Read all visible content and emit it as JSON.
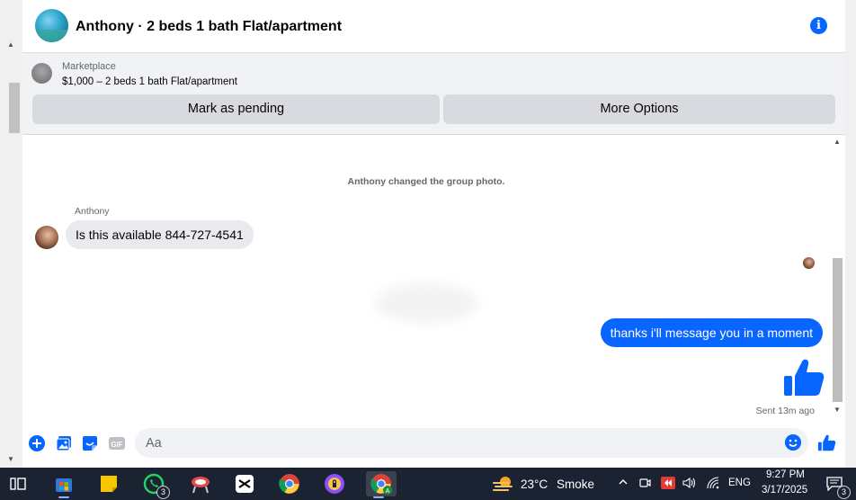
{
  "chat": {
    "title": "Anthony · 2 beds 1 bath Flat/apartment",
    "info_icon": "info-icon"
  },
  "marketplace": {
    "label": "Marketplace",
    "listing": "$1,000 – 2 beds 1 bath Flat/apartment",
    "mark_pending_label": "Mark as pending",
    "more_options_label": "More Options"
  },
  "messages": {
    "system_message": "Anthony changed the group photo.",
    "sender_name": "Anthony",
    "incoming_text": "Is this available 844-727-4541",
    "outgoing_text": "thanks i'll message you in a moment",
    "sent_status": "Sent 13m ago"
  },
  "composer": {
    "placeholder": "Aa",
    "icons": [
      "plus-icon",
      "photo-icon",
      "sticker-icon",
      "gif-icon",
      "emoji-icon",
      "thumbs-up-icon"
    ]
  },
  "taskbar": {
    "weather_temp": "23°C",
    "weather_condition": "Smoke",
    "language": "ENG",
    "time": "9:27 PM",
    "date": "3/17/2025",
    "whatsapp_badge": "3",
    "notification_badge": "3"
  },
  "colors": {
    "accent": "#0866ff",
    "taskbar_bg": "#1b2231",
    "bubble_incoming": "#e9eaed",
    "panel_bg": "#f0f2f5"
  }
}
